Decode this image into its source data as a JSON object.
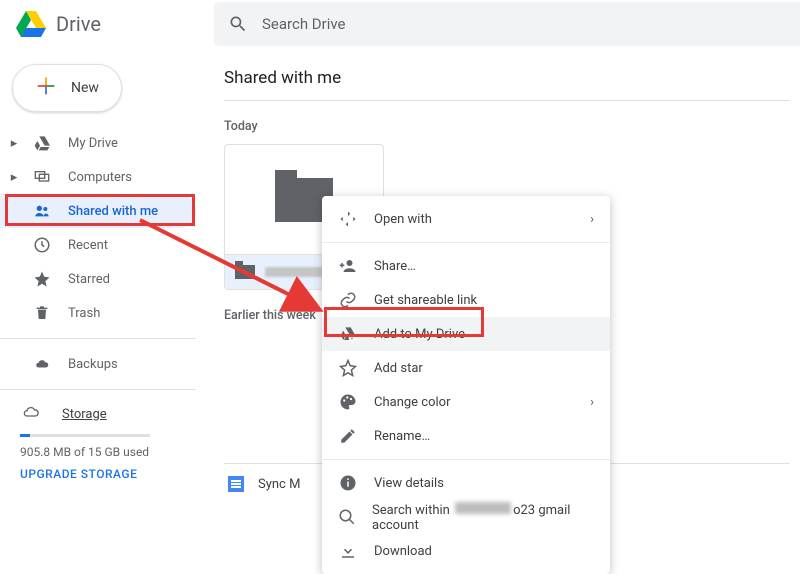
{
  "header": {
    "product": "Drive",
    "search_placeholder": "Search Drive"
  },
  "new_button": {
    "label": "New"
  },
  "sidebar": {
    "items": [
      {
        "label": "My Drive",
        "icon": "drive-icon",
        "expandable": true
      },
      {
        "label": "Computers",
        "icon": "computers-icon",
        "expandable": true
      },
      {
        "label": "Shared with me",
        "icon": "people-icon",
        "selected": true
      },
      {
        "label": "Recent",
        "icon": "clock-icon"
      },
      {
        "label": "Starred",
        "icon": "star-icon"
      },
      {
        "label": "Trash",
        "icon": "trash-icon"
      }
    ],
    "backups": {
      "label": "Backups"
    },
    "storage": {
      "label": "Storage",
      "usage_text": "905.8 MB of 15 GB used",
      "upgrade_label": "UPGRADE STORAGE"
    }
  },
  "main": {
    "title": "Shared with me",
    "sections": [
      {
        "label": "Today"
      },
      {
        "label": "Earlier this week"
      }
    ],
    "list_item": {
      "name_prefix": "Sync M"
    }
  },
  "context_menu": {
    "open_with": "Open with",
    "share": "Share…",
    "shareable_link": "Get shareable link",
    "add_to_drive": "Add to My Drive",
    "add_star": "Add star",
    "change_color": "Change color",
    "rename": "Rename…",
    "view_details": "View details",
    "search_prefix": "Search within",
    "search_suffix1": "o23",
    "search_suffix2": "gmail account",
    "download": "Download"
  }
}
